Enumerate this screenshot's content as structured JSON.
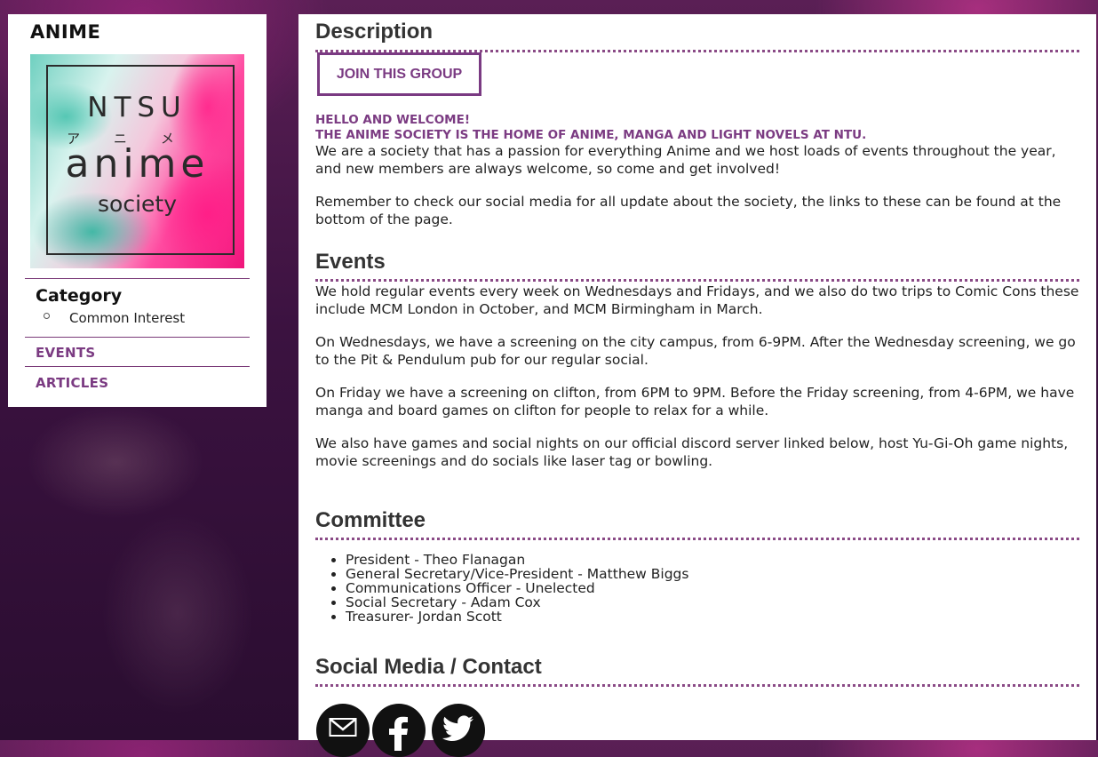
{
  "sidebar": {
    "title": "ANIME",
    "logo": {
      "line1": "NTSU",
      "kana": "アニメ",
      "line2": "anime",
      "line3": "society"
    },
    "category_heading": "Category",
    "category_items": [
      "Common Interest"
    ],
    "links": [
      "EVENTS",
      "ARTICLES"
    ]
  },
  "main": {
    "description": {
      "title": "Description",
      "join_button": "JOIN THIS GROUP",
      "highlight1": "HELLO AND WELCOME!",
      "highlight2": "THE ANIME SOCIETY IS THE HOME OF ANIME, MANGA AND LIGHT NOVELS AT NTU.",
      "para1": "We are a society that has a passion for everything Anime and we host loads of events throughout the year, and new members are always welcome, so come and get involved!",
      "para2": "Remember to check our social media for all update about the society, the links to these can be found at the bottom of the page."
    },
    "events": {
      "title": "Events",
      "para1": "We hold regular events every week on Wednesdays and Fridays, and we also do two trips to Comic Cons these include MCM London in October, and MCM Birmingham in March.",
      "para2": "On Wednesdays, we have a screening on the city campus, from 6-9PM. After the Wednesday screening, we go to the Pit & Pendulum pub for our regular social.",
      "para3": "On Friday we have a screening on clifton, from 6PM to 9PM. Before the Friday screening, from 4-6PM, we have manga and board games on clifton for people to relax for a while.",
      "para4": "We also have games and social nights on our official discord server linked below, host Yu-Gi-Oh game nights, movie screenings and do socials like laser tag or bowling."
    },
    "committee": {
      "title": "Committee",
      "members": [
        "President - Theo Flanagan",
        "General Secretary/Vice-President - Matthew Biggs",
        "Communications Officer - Unelected",
        "Social Secretary - Adam Cox",
        "Treasurer- Jordan Scott"
      ]
    },
    "social": {
      "title": "Social Media / Contact",
      "icons": [
        "email-icon",
        "facebook-icon",
        "twitter-icon"
      ]
    }
  },
  "colors": {
    "accent": "#7b3b82",
    "text": "#222222",
    "heading": "#333333"
  }
}
